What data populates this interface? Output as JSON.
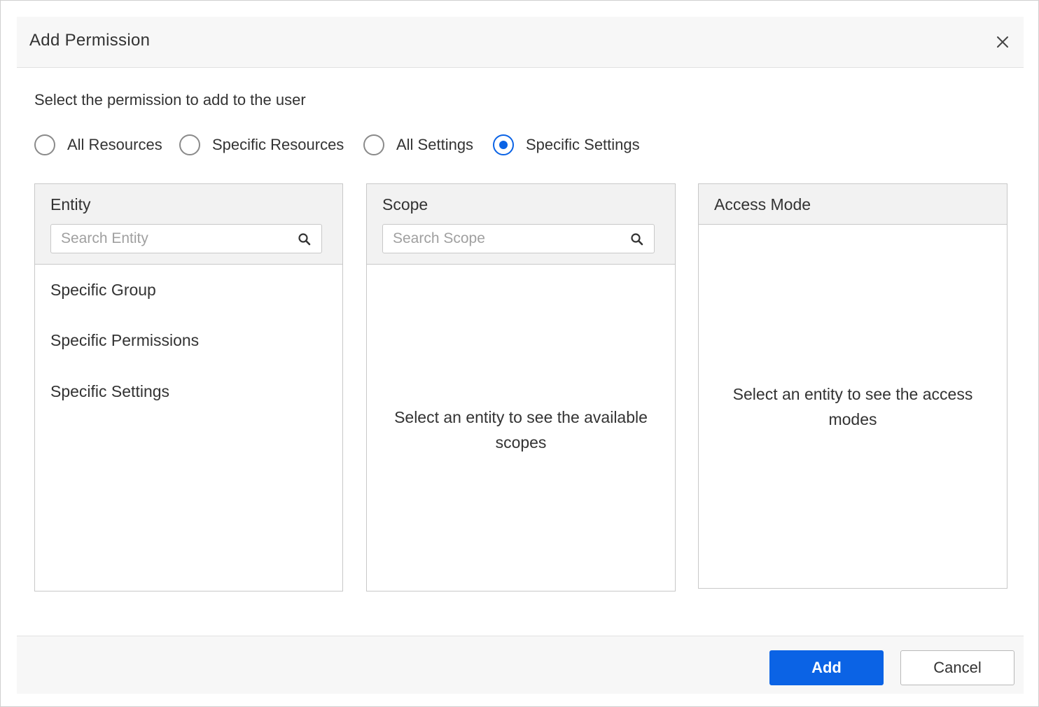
{
  "dialog": {
    "title": "Add Permission",
    "instruction": "Select the permission to add to the user"
  },
  "permission_types": [
    {
      "label": "All Resources",
      "checked": false
    },
    {
      "label": "Specific Resources",
      "checked": false
    },
    {
      "label": "All Settings",
      "checked": false
    },
    {
      "label": "Specific Settings",
      "checked": true
    }
  ],
  "entity_panel": {
    "title": "Entity",
    "search_placeholder": "Search Entity",
    "items": [
      "Specific Group",
      "Specific Permissions",
      "Specific Settings"
    ]
  },
  "scope_panel": {
    "title": "Scope",
    "search_placeholder": "Search Scope",
    "empty_line1": "Select an entity to see the available",
    "empty_line2": "scopes"
  },
  "access_mode_panel": {
    "title": "Access Mode",
    "empty_line1": "Select an entity to see the access",
    "empty_line2": "modes"
  },
  "footer": {
    "add_label": "Add",
    "cancel_label": "Cancel"
  },
  "colors": {
    "accent": "#0b63e5",
    "header_bg": "#f7f7f7",
    "panel_header_bg": "#f2f2f2",
    "border": "#c8c8c8"
  },
  "icons": [
    "close-icon",
    "search-icon"
  ]
}
